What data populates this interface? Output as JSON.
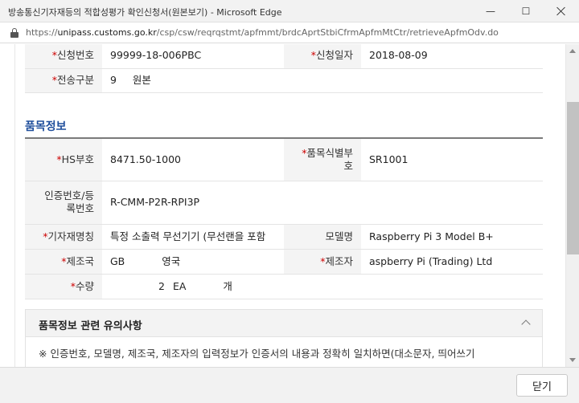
{
  "window": {
    "title": "방송통신기자재등의 적합성평가 확인신청서(원본보기) - Microsoft Edge",
    "minimize": "—",
    "maximize": "☐"
  },
  "address": {
    "scheme": "https://",
    "host": "unipass.customs.go.kr",
    "path": "/csp/csw/reqrqstmt/apfmmt/brdcAprtStbiCfrmApfmMtCtr/retrieveApfmOdv.do"
  },
  "header_rows": [
    {
      "l1": "신청번호",
      "v1": "99999-18-006PBC",
      "l2": "신청일자",
      "v2": "2018-08-09"
    },
    {
      "l1": "전송구분",
      "v1": "9     원본"
    }
  ],
  "section": {
    "title": "품목정보"
  },
  "item": {
    "hs_label": "HS부호",
    "hs_value": "8471.50-1000",
    "item_id_label_1": "품목식별부",
    "item_id_label_2": "호",
    "item_id_value": "SR1001",
    "cert_label_1": "인증번호/등",
    "cert_label_2": "록번호",
    "cert_value": "R-CMM-P2R-RPI3P",
    "device_name_label": "기자재명칭",
    "device_name_value": "특정 소출력 무선기기 (무선랜을 포함",
    "model_label": "모델명",
    "model_value": "Raspberry Pi 3 Model B+",
    "country_label": "제조국",
    "country_code": "GB",
    "country_name": "영국",
    "maker_label": "제조자",
    "maker_value": "aspberry Pi (Trading) Ltd",
    "qty_label": "수량",
    "qty_value": "2",
    "qty_unit": "EA",
    "qty_unit_name": "개"
  },
  "notice": {
    "title": "품목정보 관련 유의사항",
    "text": "※ 인증번호, 모델명, 제조국, 제조자의 입력정보가 인증서의 내용과 정확히 일치하면(대소문자, 띄어쓰기"
  },
  "footer": {
    "close_label": "닫기"
  }
}
